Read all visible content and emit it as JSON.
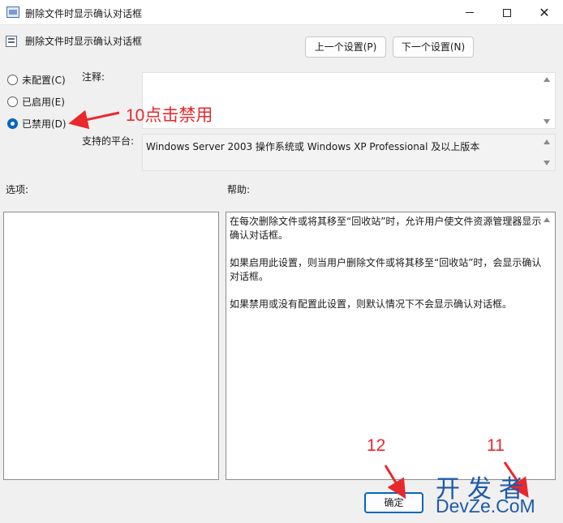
{
  "window": {
    "title": "删除文件时显示确认对话框",
    "minimize_icon": "minimize-icon",
    "maximize_icon": "maximize-icon",
    "close_icon": "close-icon",
    "close_glyph": "✕"
  },
  "header": {
    "setting_name": "删除文件时显示确认对话框",
    "prev_button": "上一个设置(P)",
    "next_button": "下一个设置(N)"
  },
  "state_options": [
    {
      "label": "未配置(C)",
      "checked": false
    },
    {
      "label": "已启用(E)",
      "checked": false
    },
    {
      "label": "已禁用(D)",
      "checked": true
    }
  ],
  "comment": {
    "label": "注释:",
    "value": ""
  },
  "supported_on": {
    "label": "支持的平台:",
    "value": "Windows Server 2003 操作系统或 Windows XP Professional 及以上版本"
  },
  "options": {
    "label": "选项:"
  },
  "help": {
    "label": "帮助:",
    "paragraphs": [
      "在每次删除文件或将其移至“回收站”时，允许用户使文件资源管理器显示确认对话框。",
      "如果启用此设置，则当用户删除文件或将其移至“回收站”时，会显示确认对话框。",
      "如果禁用或没有配置此设置，则默认情况下不会显示确认对话框。"
    ]
  },
  "footer": {
    "ok_button": "确定"
  },
  "annotations": {
    "step10": "10点击禁用",
    "step12": "12",
    "step11": "11",
    "color": "#e8282d"
  },
  "watermark": {
    "line1": "开发者",
    "line2": "DevZe.CoM",
    "color": "#1e5aa8"
  }
}
